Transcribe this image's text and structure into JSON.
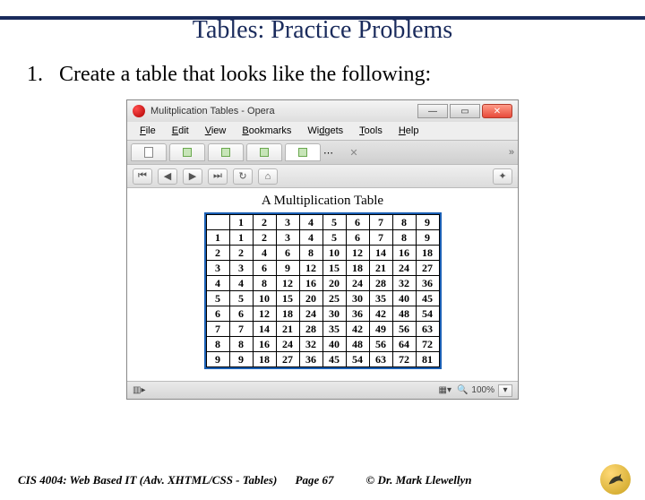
{
  "slide": {
    "title": "Tables:  Practice Problems",
    "problem_number": "1.",
    "problem_text": "Create a table that looks like the following:"
  },
  "browser": {
    "window_title": "Mulitplication Tables - Opera",
    "menu": [
      "File",
      "Edit",
      "View",
      "Bookmarks",
      "Widgets",
      "Tools",
      "Help"
    ],
    "zoom": "100%",
    "content_title": "A Multiplication Table"
  },
  "chart_data": {
    "type": "table",
    "title": "A Multiplication Table",
    "columns": [
      "",
      "1",
      "2",
      "3",
      "4",
      "5",
      "6",
      "7",
      "8",
      "9"
    ],
    "rows": [
      [
        "1",
        "1",
        "2",
        "3",
        "4",
        "5",
        "6",
        "7",
        "8",
        "9"
      ],
      [
        "2",
        "2",
        "4",
        "6",
        "8",
        "10",
        "12",
        "14",
        "16",
        "18"
      ],
      [
        "3",
        "3",
        "6",
        "9",
        "12",
        "15",
        "18",
        "21",
        "24",
        "27"
      ],
      [
        "4",
        "4",
        "8",
        "12",
        "16",
        "20",
        "24",
        "28",
        "32",
        "36"
      ],
      [
        "5",
        "5",
        "10",
        "15",
        "20",
        "25",
        "30",
        "35",
        "40",
        "45"
      ],
      [
        "6",
        "6",
        "12",
        "18",
        "24",
        "30",
        "36",
        "42",
        "48",
        "54"
      ],
      [
        "7",
        "7",
        "14",
        "21",
        "28",
        "35",
        "42",
        "49",
        "56",
        "63"
      ],
      [
        "8",
        "8",
        "16",
        "24",
        "32",
        "40",
        "48",
        "56",
        "64",
        "72"
      ],
      [
        "9",
        "9",
        "18",
        "27",
        "36",
        "45",
        "54",
        "63",
        "72",
        "81"
      ]
    ]
  },
  "footer": {
    "course": "CIS 4004: Web Based IT (Adv. XHTML/CSS - Tables)",
    "page": "Page 67",
    "author": "© Dr. Mark Llewellyn"
  }
}
